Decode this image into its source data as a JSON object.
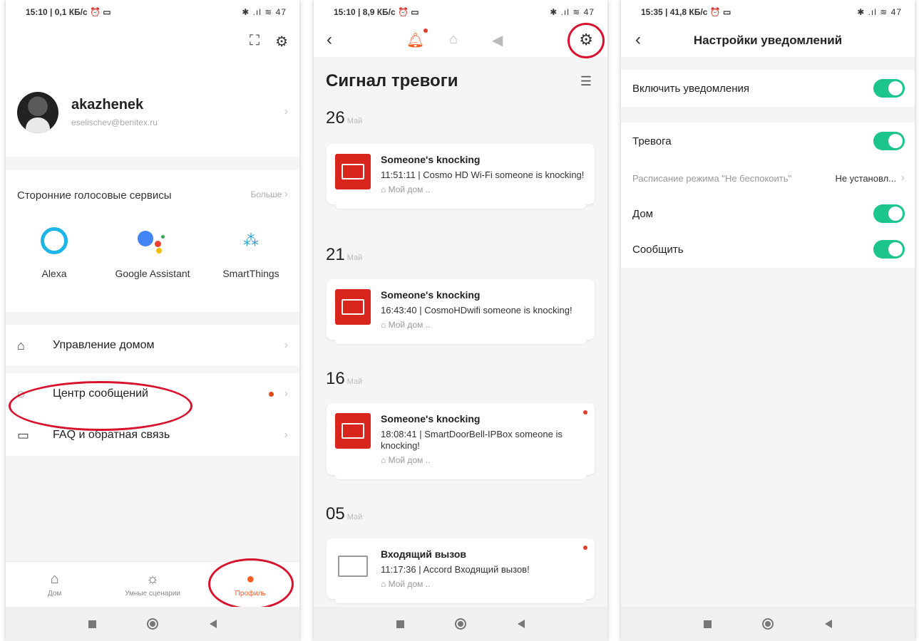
{
  "panel1": {
    "status": {
      "time": "15:10 | 0,1 КБ/с ⏰ ▭",
      "icons": "✱ .ıl ≋ 47"
    },
    "header_icons": {
      "scan": "scan-icon",
      "settings": "settings-icon"
    },
    "profile": {
      "username": "akazhenek",
      "email": "eselischev@benitex.ru"
    },
    "voice": {
      "title": "Сторонние голосовые сервисы",
      "more": "Больше",
      "services": [
        {
          "name": "Alexa"
        },
        {
          "name": "Google Assistant"
        },
        {
          "name": "SmartThings"
        }
      ]
    },
    "menu": [
      {
        "label": "Управление домом"
      },
      {
        "label": "Центр сообщений"
      },
      {
        "label": "FAQ и обратная связь"
      }
    ],
    "tabs": [
      {
        "label": "Дом"
      },
      {
        "label": "Умные сценарии"
      },
      {
        "label": "Профиль"
      }
    ]
  },
  "panel2": {
    "status": {
      "time": "15:10 | 8,9 КБ/с ⏰ ▭",
      "icons": "✱ .ıl ≋ 47"
    },
    "title": "Сигнал тревоги",
    "groups": [
      {
        "day": "26",
        "month": "Май",
        "title": "Someone's knocking",
        "desc": "11:51:11 | Cosmo HD Wi-Fi someone is knocking!",
        "loc": "Мой дом .."
      },
      {
        "day": "21",
        "month": "Май",
        "title": "Someone's knocking",
        "desc": "16:43:40 | CosmoHDwifi someone is knocking!",
        "loc": "Мой дом .."
      },
      {
        "day": "16",
        "month": "Май",
        "title": "Someone's knocking",
        "desc": "18:08:41 | SmartDoorBell-IPBox someone is knocking!",
        "loc": "Мой дом .."
      },
      {
        "day": "05",
        "month": "Май",
        "title": "Входящий вызов",
        "desc": "11:17:36 | Accord Входящий вызов!",
        "loc": "Мой дом .."
      }
    ]
  },
  "panel3": {
    "status": {
      "time": "15:35 | 41,8 КБ/с ⏰ ▭",
      "icons": "✱ .ıl ≋ 47"
    },
    "title": "Настройки уведомлений",
    "rows": {
      "enable": "Включить уведомления",
      "alarm": "Тревога",
      "dnd": "Расписание режима \"Не беспокоить\"",
      "dnd_value": "Не установл...",
      "home": "Дом",
      "report": "Сообщить"
    }
  },
  "colors": {
    "accent": "#ff5a1f",
    "toggle_on": "#1bc58b",
    "alert_red": "#d9261c",
    "highlight_ring": "#d8112d"
  }
}
